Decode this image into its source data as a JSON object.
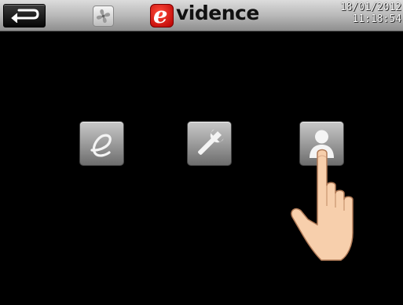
{
  "header": {
    "logo_letter": "e",
    "logo_text": "vidence",
    "date": "18/01/2012",
    "time": "11:18:54"
  },
  "buttons": {
    "back": "back-arrow-icon",
    "fan": "fan-icon",
    "evidence": "evidence-e-icon",
    "settings": "wrench-icon",
    "user": "user-icon"
  },
  "overlay": {
    "pointer": "pointing-hand-icon"
  },
  "colors": {
    "background": "#000000",
    "topbar": "#b9b9b9",
    "logo_red": "#d40000",
    "tile": "#9c9c9c"
  }
}
